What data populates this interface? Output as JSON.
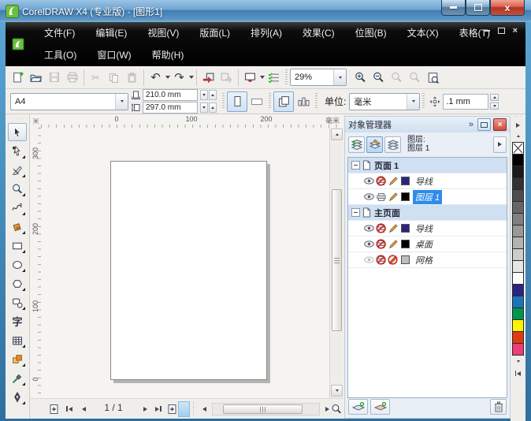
{
  "titlebar": {
    "title": "CorelDRAW X4 (专业版) - [图形1]"
  },
  "menubar": {
    "row1": [
      "文件(F)",
      "编辑(E)",
      "视图(V)",
      "版面(L)",
      "排列(A)",
      "效果(C)",
      "位图(B)",
      "文本(X)",
      "表格(T)"
    ],
    "row2": [
      "工具(O)",
      "窗口(W)",
      "帮助(H)"
    ]
  },
  "toolbar": {
    "zoom_value": "29%"
  },
  "propbar": {
    "preset": "A4",
    "paper_width": "210.0 mm",
    "paper_height": "297.0 mm",
    "units_label": "单位:",
    "units_value": "毫米",
    "nudge_value": ".1 mm"
  },
  "rulers": {
    "h_ticks": [
      "0",
      "100",
      "200"
    ],
    "v_ticks": [
      "300",
      "200",
      "100",
      "0"
    ],
    "unit_label": "毫米"
  },
  "statusbar": {
    "page_indicator": "1 / 1"
  },
  "docker": {
    "title": "对象管理器",
    "layer_caption": "图层:",
    "active_layer": "图层 1",
    "groups": [
      {
        "label": "页面 1",
        "layers": [
          {
            "name": "导线",
            "color": "#2b2483",
            "visible": true,
            "print": false,
            "edit": true,
            "selected": false
          },
          {
            "name": "图层 1",
            "color": "#000000",
            "visible": true,
            "print": true,
            "edit": true,
            "selected": true
          }
        ]
      },
      {
        "label": "主页面",
        "layers": [
          {
            "name": "导线",
            "color": "#2b2483",
            "visible": true,
            "print": false,
            "edit": true,
            "selected": false
          },
          {
            "name": "桌面",
            "color": "#000000",
            "visible": true,
            "print": false,
            "edit": true,
            "selected": false
          },
          {
            "name": "网格",
            "color": "#bdbdbd",
            "visible": false,
            "print": false,
            "edit": false,
            "selected": false
          }
        ]
      }
    ]
  },
  "palette": {
    "colors": [
      "none",
      "#000000",
      "#1a1a1a",
      "#333333",
      "#4d4d4d",
      "#666666",
      "#808080",
      "#999999",
      "#b3b3b3",
      "#cccccc",
      "#e6e6e6",
      "#ffffff",
      "#2b2483",
      "#1c75bc",
      "#00944e",
      "#fff200",
      "#e13a10",
      "#ed3c78"
    ]
  },
  "icons": {
    "chevron_double_right": "»",
    "close": "×",
    "undo": "↶",
    "redo": "↷",
    "scissors": "✂",
    "text_tool": "字",
    "grip_dots": "·····",
    "pal_grip": "···"
  }
}
